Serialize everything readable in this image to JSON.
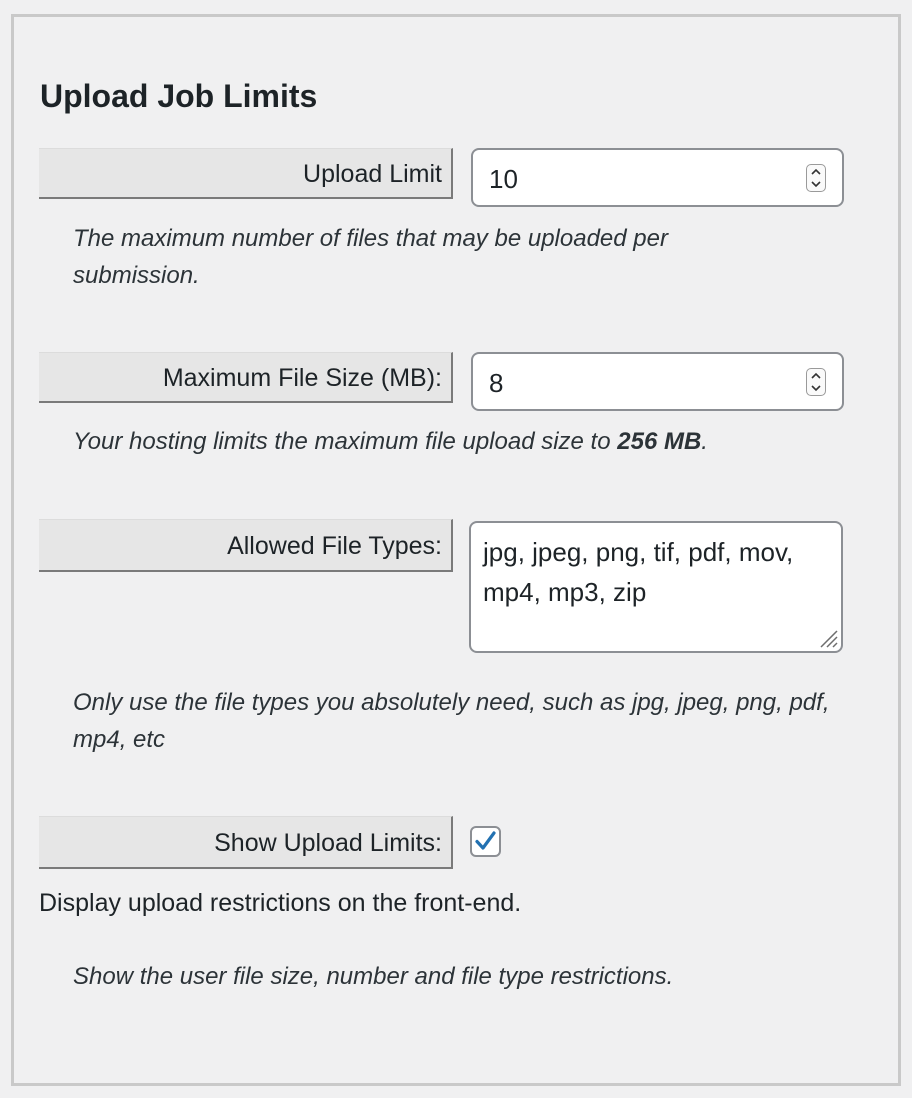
{
  "section": {
    "title": "Upload Job Limits"
  },
  "upload_limit": {
    "label": "Upload Limit",
    "value": "10",
    "description": "The maximum number of files that may be uploaded per submission."
  },
  "max_file_size": {
    "label": "Maximum File Size (MB):",
    "value": "8",
    "description_prefix": "Your hosting limits the maximum file upload size to ",
    "description_bold": "256 MB",
    "description_suffix": "."
  },
  "allowed_types": {
    "label": "Allowed File Types:",
    "value": "jpg, jpeg, png, tif, pdf, mov, mp4, mp3, zip",
    "description": "Only use the file types you absolutely need, such as jpg, jpeg, png, pdf, mp4, etc"
  },
  "show_limits": {
    "label": "Show Upload Limits:",
    "checked": true,
    "checkbox_text": "Display upload restrictions on the front-end.",
    "description": "Show the user file size, number and file type restrictions."
  },
  "colors": {
    "accent": "#2271b1",
    "background": "#f0f0f1",
    "label_bg": "#e6e6e6"
  }
}
